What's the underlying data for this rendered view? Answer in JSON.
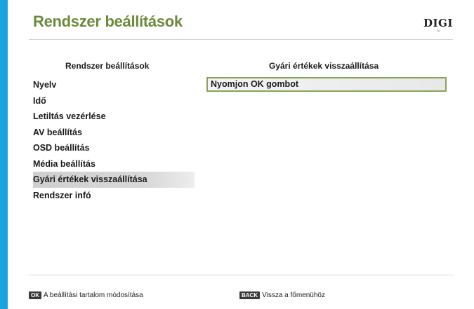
{
  "header": {
    "title": "Rendszer beállítások",
    "logo": "DIGI",
    "logo_sub": "tv"
  },
  "left_panel": {
    "header": "Rendszer beállítások",
    "items": [
      {
        "label": "Nyelv"
      },
      {
        "label": "Idő"
      },
      {
        "label": "Letiltás vezérlése"
      },
      {
        "label": "AV beállítás"
      },
      {
        "label": "OSD beállítás"
      },
      {
        "label": "Média beállítás"
      },
      {
        "label": "Gyári értékek visszaállítása",
        "selected": true
      },
      {
        "label": "Rendszer infó"
      }
    ]
  },
  "right_panel": {
    "header": "Gyári értékek visszaállítása",
    "option": "Nyomjon OK gombot"
  },
  "footer": {
    "ok_key": "OK",
    "ok_text": "A beállítási tartalom módosítása",
    "back_key": "BACK",
    "back_text": "Vissza a főmenühöz"
  },
  "colors": {
    "frame": "#19a3df",
    "title": "#6c8a3c",
    "highlight": "#8aa35a"
  }
}
